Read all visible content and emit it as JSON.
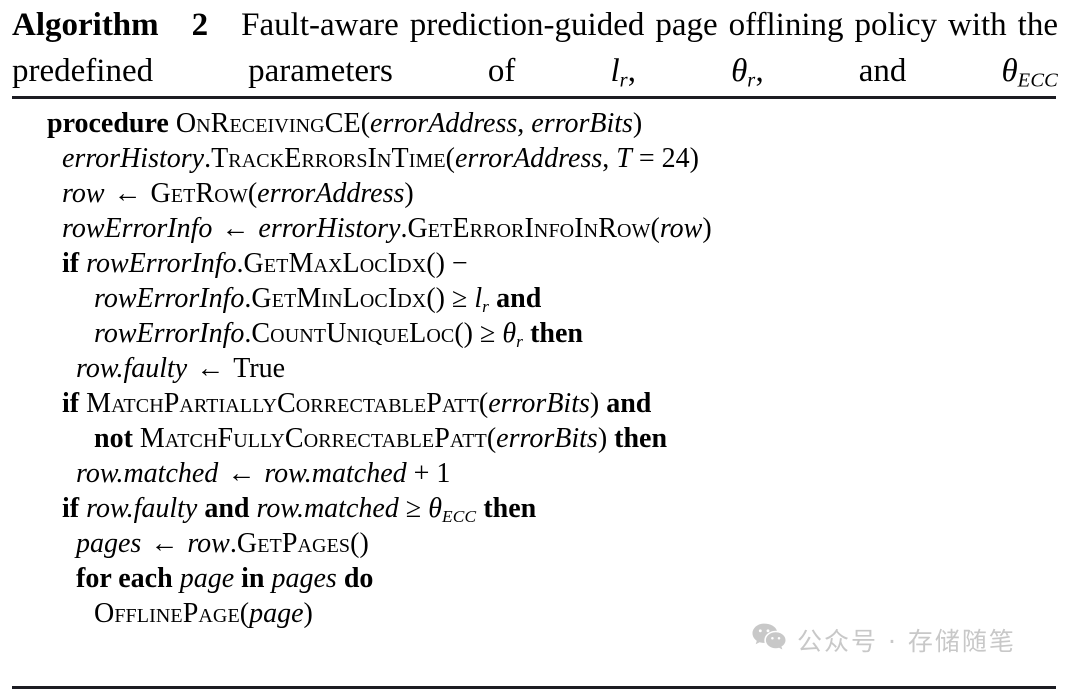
{
  "figure": {
    "kind": "algorithm-block",
    "title": {
      "keyword": "Algorithm",
      "number": "2",
      "text_line1": "Fault-aware prediction-guided page offlining",
      "text_line2_prefix": "policy with the predefined parameters of ",
      "param1_base": "l",
      "param1_sub": "r",
      "sep1": ", ",
      "param2_base": "θ",
      "param2_sub": "r",
      "sep2": ", and ",
      "param3_base": "θ",
      "param3_sub": "ECC"
    },
    "lines": [
      {
        "indent": 0,
        "parts": [
          {
            "style": "kw",
            "text": "procedure"
          },
          {
            "style": "sp",
            "text": " "
          },
          {
            "style": "sc",
            "text": "OnReceivingCE"
          },
          {
            "style": "rm",
            "text": "("
          },
          {
            "style": "var",
            "text": "errorAddress"
          },
          {
            "style": "rm",
            "text": ", "
          },
          {
            "style": "var",
            "text": "errorBits"
          },
          {
            "style": "rm",
            "text": ")"
          }
        ]
      },
      {
        "indent": 1,
        "parts": [
          {
            "style": "var",
            "text": "errorHistory"
          },
          {
            "style": "rm",
            "text": "."
          },
          {
            "style": "sc",
            "text": "TrackErrorsInTime"
          },
          {
            "style": "rm",
            "text": "("
          },
          {
            "style": "var",
            "text": "errorAddress"
          },
          {
            "style": "rm",
            "text": ", "
          },
          {
            "style": "var",
            "text": "T"
          },
          {
            "style": "op",
            "text": " = "
          },
          {
            "style": "rm",
            "text": "24)"
          }
        ]
      },
      {
        "indent": 1,
        "parts": [
          {
            "style": "var",
            "text": "row"
          },
          {
            "style": "arrow",
            "text": " ← "
          },
          {
            "style": "sc",
            "text": "GetRow"
          },
          {
            "style": "rm",
            "text": "("
          },
          {
            "style": "var",
            "text": "errorAddress"
          },
          {
            "style": "rm",
            "text": ")"
          }
        ]
      },
      {
        "indent": 1,
        "parts": [
          {
            "style": "var",
            "text": "rowErrorInfo"
          },
          {
            "style": "arrow",
            "text": " ← "
          },
          {
            "style": "var",
            "text": "errorHistory"
          },
          {
            "style": "rm",
            "text": "."
          },
          {
            "style": "sc",
            "text": "GetErrorInfoInRow"
          },
          {
            "style": "rm",
            "text": "("
          },
          {
            "style": "var",
            "text": "row"
          },
          {
            "style": "rm",
            "text": ")"
          }
        ]
      },
      {
        "indent": 1,
        "parts": [
          {
            "style": "kw",
            "text": "if"
          },
          {
            "style": "sp",
            "text": " "
          },
          {
            "style": "var",
            "text": "rowErrorInfo"
          },
          {
            "style": "rm",
            "text": "."
          },
          {
            "style": "sc",
            "text": "GetMaxLocIdx"
          },
          {
            "style": "rm",
            "text": "()"
          },
          {
            "style": "op",
            "text": " −"
          }
        ]
      },
      {
        "indent": 3,
        "parts": [
          {
            "style": "var",
            "text": "rowErrorInfo"
          },
          {
            "style": "rm",
            "text": "."
          },
          {
            "style": "sc",
            "text": "GetMinLocIdx"
          },
          {
            "style": "rm",
            "text": "()"
          },
          {
            "style": "op",
            "text": " ≥ "
          },
          {
            "style": "mi-sub",
            "base": "l",
            "sub": "r"
          },
          {
            "style": "sp",
            "text": " "
          },
          {
            "style": "kw",
            "text": "and"
          }
        ]
      },
      {
        "indent": 3,
        "parts": [
          {
            "style": "var",
            "text": "rowErrorInfo"
          },
          {
            "style": "rm",
            "text": "."
          },
          {
            "style": "sc",
            "text": "CountUniqueLoc"
          },
          {
            "style": "rm",
            "text": "()"
          },
          {
            "style": "op",
            "text": " ≥ "
          },
          {
            "style": "mi-sub",
            "base": "θ",
            "sub": "r"
          },
          {
            "style": "sp",
            "text": " "
          },
          {
            "style": "kw",
            "text": "then"
          }
        ]
      },
      {
        "indent": 2,
        "parts": [
          {
            "style": "var",
            "text": "row.faulty"
          },
          {
            "style": "arrow",
            "text": " ← "
          },
          {
            "style": "rm",
            "text": "True"
          }
        ]
      },
      {
        "indent": 1,
        "parts": [
          {
            "style": "kw",
            "text": "if"
          },
          {
            "style": "sp",
            "text": " "
          },
          {
            "style": "sc",
            "text": "MatchPartiallyCorrectablePatt"
          },
          {
            "style": "rm",
            "text": "("
          },
          {
            "style": "var",
            "text": "errorBits"
          },
          {
            "style": "rm",
            "text": ") "
          },
          {
            "style": "kw",
            "text": "and"
          }
        ]
      },
      {
        "indent": 3,
        "parts": [
          {
            "style": "kw",
            "text": "not"
          },
          {
            "style": "sp",
            "text": " "
          },
          {
            "style": "sc",
            "text": "MatchFullyCorrectablePatt"
          },
          {
            "style": "rm",
            "text": "("
          },
          {
            "style": "var",
            "text": "errorBits"
          },
          {
            "style": "rm",
            "text": ") "
          },
          {
            "style": "kw",
            "text": "then"
          }
        ]
      },
      {
        "indent": 2,
        "parts": [
          {
            "style": "var",
            "text": "row.matched"
          },
          {
            "style": "arrow",
            "text": " ← "
          },
          {
            "style": "var",
            "text": "row.matched"
          },
          {
            "style": "op",
            "text": " + "
          },
          {
            "style": "rm",
            "text": "1"
          }
        ]
      },
      {
        "indent": 1,
        "parts": [
          {
            "style": "kw",
            "text": "if"
          },
          {
            "style": "sp",
            "text": " "
          },
          {
            "style": "var",
            "text": "row.faulty"
          },
          {
            "style": "sp",
            "text": " "
          },
          {
            "style": "kw",
            "text": "and"
          },
          {
            "style": "sp",
            "text": " "
          },
          {
            "style": "var",
            "text": "row.matched"
          },
          {
            "style": "op",
            "text": " ≥ "
          },
          {
            "style": "mi-sub",
            "base": "θ",
            "sub": "ECC"
          },
          {
            "style": "sp",
            "text": " "
          },
          {
            "style": "kw",
            "text": "then"
          }
        ]
      },
      {
        "indent": 2,
        "parts": [
          {
            "style": "var",
            "text": "pages"
          },
          {
            "style": "arrow",
            "text": " ← "
          },
          {
            "style": "var",
            "text": "row"
          },
          {
            "style": "rm",
            "text": "."
          },
          {
            "style": "sc",
            "text": "GetPages"
          },
          {
            "style": "rm",
            "text": "()"
          }
        ]
      },
      {
        "indent": 2,
        "parts": [
          {
            "style": "kw",
            "text": "for each"
          },
          {
            "style": "sp",
            "text": " "
          },
          {
            "style": "var",
            "text": "page"
          },
          {
            "style": "sp",
            "text": " "
          },
          {
            "style": "kw",
            "text": "in"
          },
          {
            "style": "sp",
            "text": " "
          },
          {
            "style": "var",
            "text": "pages"
          },
          {
            "style": "sp",
            "text": " "
          },
          {
            "style": "kw",
            "text": "do"
          }
        ]
      },
      {
        "indent": 3,
        "parts": [
          {
            "style": "sc",
            "text": "OfflinePage"
          },
          {
            "style": "rm",
            "text": "("
          },
          {
            "style": "var",
            "text": "page"
          },
          {
            "style": "rm",
            "text": ")"
          }
        ]
      }
    ]
  },
  "watermark": {
    "icon": "wechat-icon",
    "text": "公众号 · 存储随笔",
    "color": "#c8c8c8"
  },
  "colors": {
    "background": "#ffffff",
    "text": "#000000",
    "rule": "#1c1c22",
    "watermark": "#c8c8c8"
  }
}
